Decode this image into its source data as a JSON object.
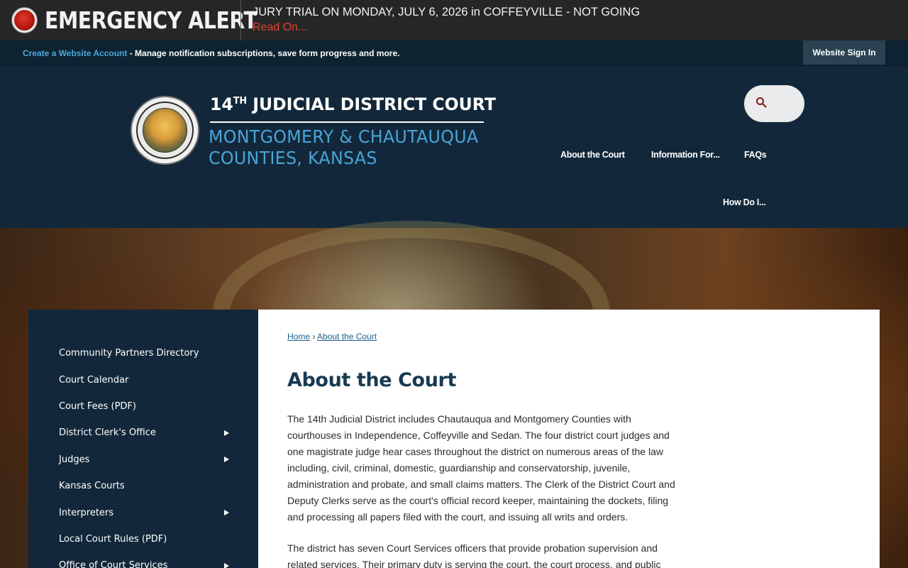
{
  "alert": {
    "title": "EMERGENCY ALERT",
    "message": "JURY TRIAL ON MONDAY, JULY 6, 2026 in COFFEYVILLE - NOT GOING",
    "link": "Read On..."
  },
  "account": {
    "create_link": "Create a Website Account",
    "description": " - Manage notification subscriptions, save form progress and more.",
    "signin": "Website Sign In"
  },
  "header": {
    "title_number": "14",
    "title_suffix": "TH",
    "title_rest": " JUDICIAL DISTRICT COURT",
    "subtitle_line1": "MONTGOMERY & CHAUTAUQUA",
    "subtitle_line2": "COUNTIES, KANSAS"
  },
  "nav": {
    "about": "About the Court",
    "info": "Information For...",
    "faqs": "FAQs",
    "howdo": "How Do I..."
  },
  "sidebar": {
    "items": [
      {
        "label": "Community Partners Directory",
        "has_submenu": false
      },
      {
        "label": "Court Calendar",
        "has_submenu": false
      },
      {
        "label": "Court Fees (PDF)",
        "has_submenu": false
      },
      {
        "label": "District Clerk's Office",
        "has_submenu": true
      },
      {
        "label": "Judges",
        "has_submenu": true
      },
      {
        "label": "Kansas Courts",
        "has_submenu": false
      },
      {
        "label": "Interpreters",
        "has_submenu": true
      },
      {
        "label": "Local Court Rules (PDF)",
        "has_submenu": false
      },
      {
        "label": "Office of Court Services",
        "has_submenu": true
      }
    ]
  },
  "breadcrumb": {
    "home": "Home",
    "separator": "›",
    "current": "About the Court"
  },
  "main": {
    "title": "About the Court",
    "paragraph1": "The 14th Judicial District includes Chautauqua and Montgomery Counties with courthouses in Independence, Coffeyville and Sedan.  The four district court judges and one magistrate judge hear cases throughout the district on numerous areas of the law including, civil, criminal, domestic, guardianship and conservatorship, juvenile, administration and probate, and small claims matters.  The Clerk of the District Court and Deputy Clerks serve as the court's official record keeper, maintaining the dockets, filing and processing all papers filed with the court, and issuing all writs and orders.",
    "paragraph2": "The district has seven Court Services officers that provide probation supervision and related services.  Their primary duty is serving the court, the court process, and public"
  },
  "colors": {
    "header_bg": "#12283a",
    "accent_blue": "#4aa3d8",
    "alert_red": "#e2442f"
  }
}
